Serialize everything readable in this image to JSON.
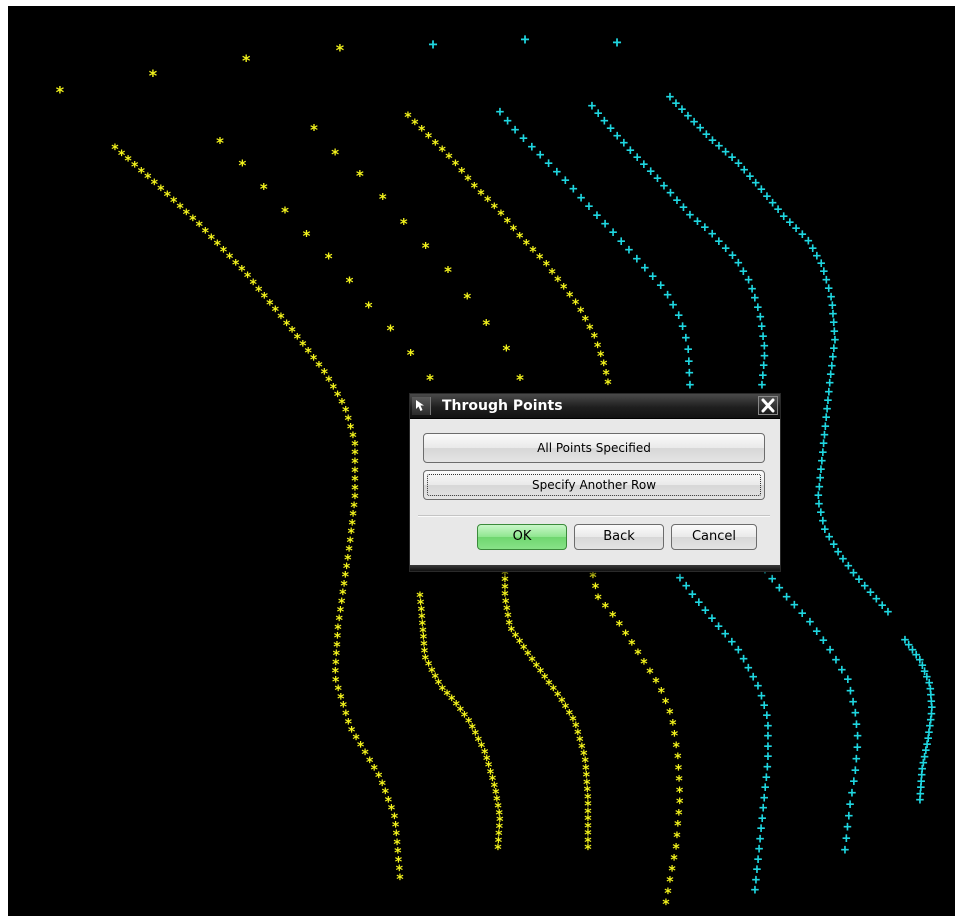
{
  "dialog": {
    "title": "Through Points",
    "all_points_label": "All Points Specified",
    "another_row_label": "Specify Another Row",
    "ok_label": "OK",
    "back_label": "Back",
    "cancel_label": "Cancel"
  },
  "colors": {
    "background": "#000000",
    "yellow_points": "#f2f21c",
    "cyan_points": "#1fd6e0",
    "ok_button": "#8fe68f"
  },
  "markers": {
    "specified_point_glyph": "*",
    "pending_point_glyph": "+"
  },
  "icons": {
    "title_icon": "select-arrow-icon",
    "close_icon": "close-icon"
  }
}
